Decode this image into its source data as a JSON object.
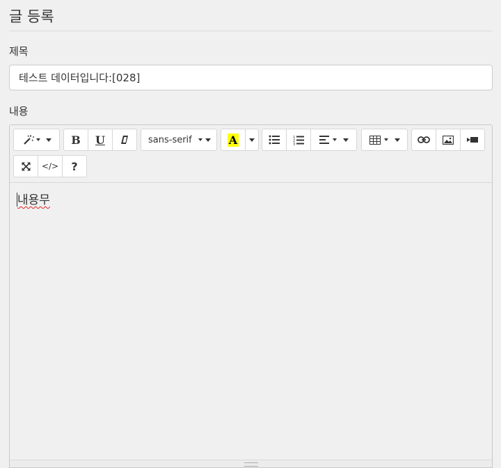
{
  "page": {
    "title": "글 등록"
  },
  "form": {
    "subject_label": "제목",
    "subject_value": "테스트 데이터입니다:[028]",
    "content_label": "내용"
  },
  "toolbar": {
    "font_name": "sans-serif",
    "bold_label": "B",
    "underline_label": "U",
    "color_label": "A",
    "code_view_label": "</>",
    "help_label": "?",
    "colors": {
      "highlight": "#ffff00"
    }
  },
  "editor": {
    "content": "내용무"
  }
}
